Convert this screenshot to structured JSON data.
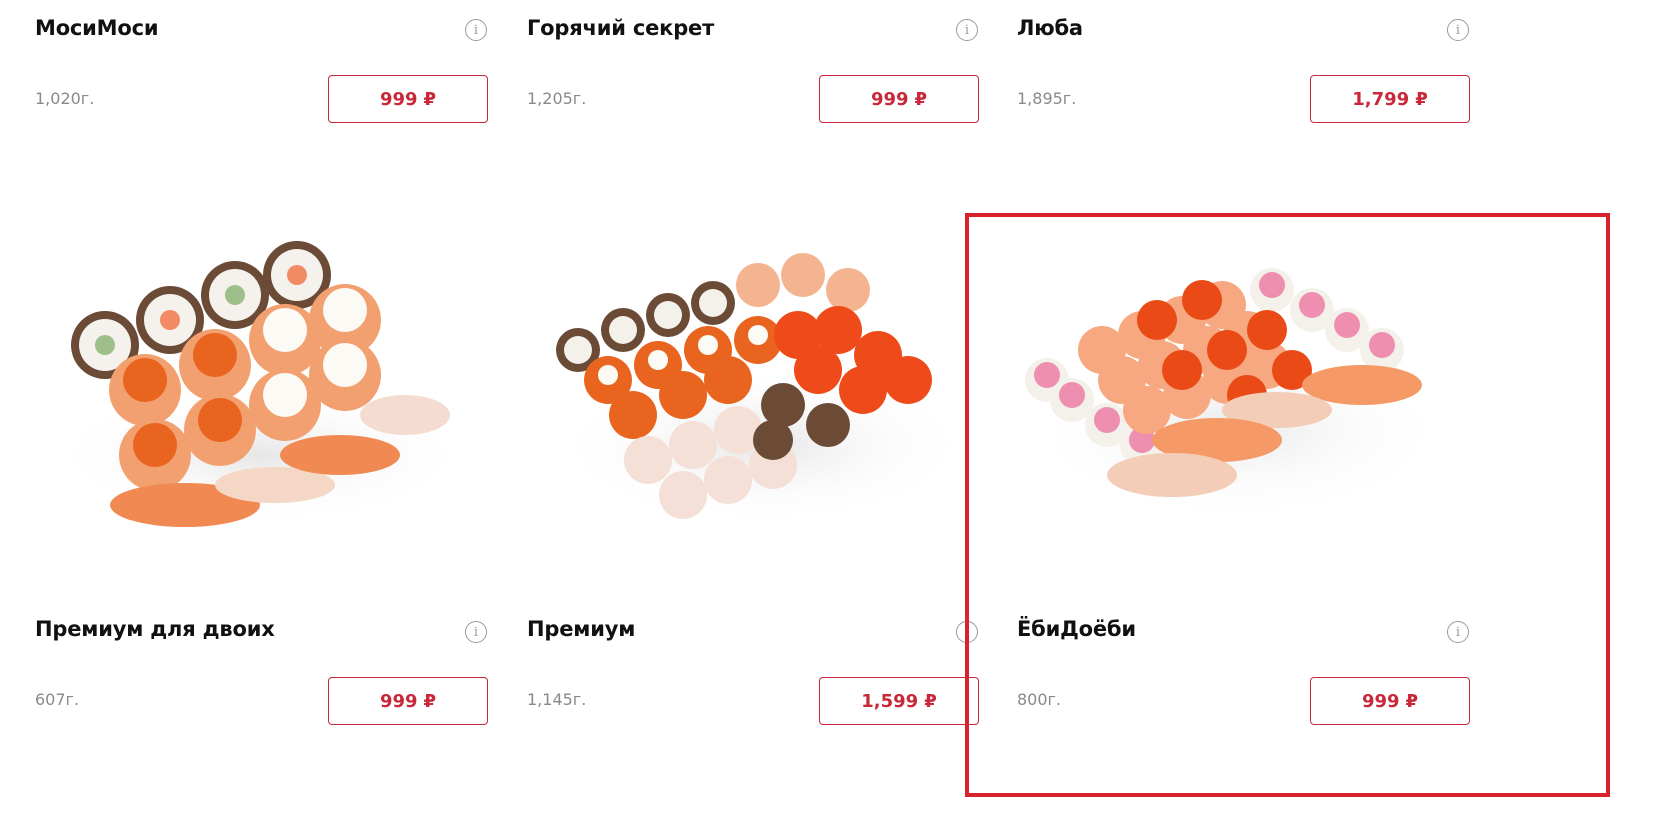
{
  "products": [
    {
      "name": "МосиМоси",
      "weight": "1,020г.",
      "price": "999",
      "currency": "₽"
    },
    {
      "name": "Горячий секрет",
      "weight": "1,205г.",
      "price": "999",
      "currency": "₽"
    },
    {
      "name": "Люба",
      "weight": "1,895г.",
      "price": "1,799",
      "currency": "₽"
    },
    {
      "name": "Премиум для двоих",
      "weight": "607г.",
      "price": "999",
      "currency": "₽"
    },
    {
      "name": "Премиум",
      "weight": "1,145г.",
      "price": "1,599",
      "currency": "₽"
    },
    {
      "name": "ЁбиДоёби",
      "weight": "800г.",
      "price": "999",
      "currency": "₽"
    }
  ],
  "info_icon": "info-icon",
  "colors": {
    "accent": "#c8283a",
    "highlight": "#d8222e",
    "title": "#111111",
    "muted": "#8a8a8a"
  }
}
